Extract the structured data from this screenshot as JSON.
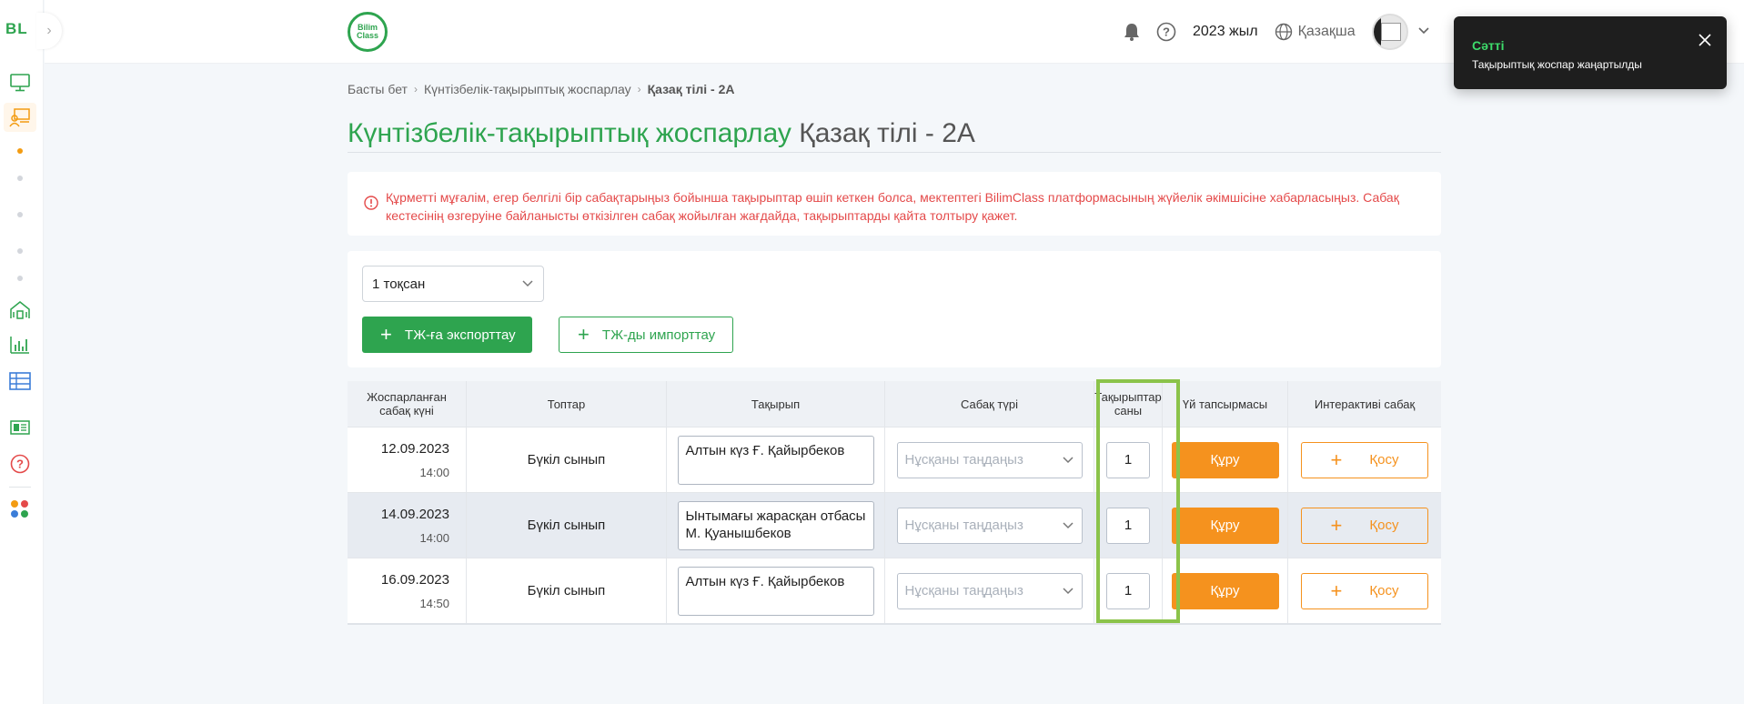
{
  "sidebar": {
    "logo": "BL",
    "collapse_icon": "chevron-right-icon",
    "items": [
      {
        "icon": "monitor-icon"
      },
      {
        "icon": "classroom-icon",
        "active": true
      },
      {
        "icon": "school-icon"
      },
      {
        "icon": "chart-icon"
      },
      {
        "icon": "table-icon"
      },
      {
        "icon": "id-card-icon"
      },
      {
        "icon": "help-circle-icon"
      },
      {
        "icon": "apps-dots-icon"
      }
    ]
  },
  "header": {
    "brand_line1": "Bilim",
    "brand_line2": "Class",
    "year": "2023 жыл",
    "language": "Қазақша"
  },
  "toast": {
    "title": "Сәтті",
    "message": "Тақырыптық жоспар жаңартылды"
  },
  "breadcrumb": {
    "home": "Басты бет",
    "section": "Күнтізбелік-тақырыптық жоспарлау",
    "current": "Қазақ тілі - 2А"
  },
  "page": {
    "title_main": "Күнтізбелік-тақырыптық жоспарлау",
    "title_sub": "Қазақ тілі - 2А"
  },
  "alert": {
    "text": "Құрметті мұғалім, егер белгілі бір сабақтарыңыз бойынша тақырыптар өшіп кеткен болса, мектептегі BilimClass платформасының жүйелік әкімшісіне хабарласыңыз. Сабақ кестесінің өзгеруіне байланысты өткізілген сабақ жойылған жағдайда, тақырыптарды қайта толтыру қажет."
  },
  "controls": {
    "quarter": "1 тоқсан",
    "export_label": "ТЖ-ға экспорттау",
    "import_label": "ТЖ-ды импорттау"
  },
  "table": {
    "headers": {
      "date": "Жоспарланған сабақ күні",
      "groups": "Топтар",
      "topic": "Тақырып",
      "type": "Сабақ түрі",
      "count": "Тақырыптар саны",
      "homework": "Үй тапсырмасы",
      "interactive": "Интерактиві сабақ"
    },
    "rows": [
      {
        "date": "12.09.2023",
        "time": "14:00",
        "group": "Бүкіл сынып",
        "topic": "Алтын күз Ғ. Қайырбеков",
        "type_placeholder": "Нұсқаны таңдаңыз",
        "count": "1",
        "homework_btn": "Құру",
        "interactive_btn": "Қосу"
      },
      {
        "date": "14.09.2023",
        "time": "14:00",
        "group": "Бүкіл сынып",
        "topic": "Ынтымағы жарасқан отбасы М. Қуанышбеков",
        "type_placeholder": "Нұсқаны таңдаңыз",
        "count": "1",
        "homework_btn": "Құру",
        "interactive_btn": "Қосу"
      },
      {
        "date": "16.09.2023",
        "time": "14:50",
        "group": "Бүкіл сынып",
        "topic": "Алтын күз Ғ. Қайырбеков",
        "type_placeholder": "Нұсқаны таңдаңыз",
        "count": "1",
        "homework_btn": "Құру",
        "interactive_btn": "Қосу"
      }
    ]
  },
  "colors": {
    "brand_green": "#2ea44f",
    "accent_orange": "#f5921e",
    "alert_red": "#e44a4a",
    "highlight_green": "#8bc34a"
  }
}
